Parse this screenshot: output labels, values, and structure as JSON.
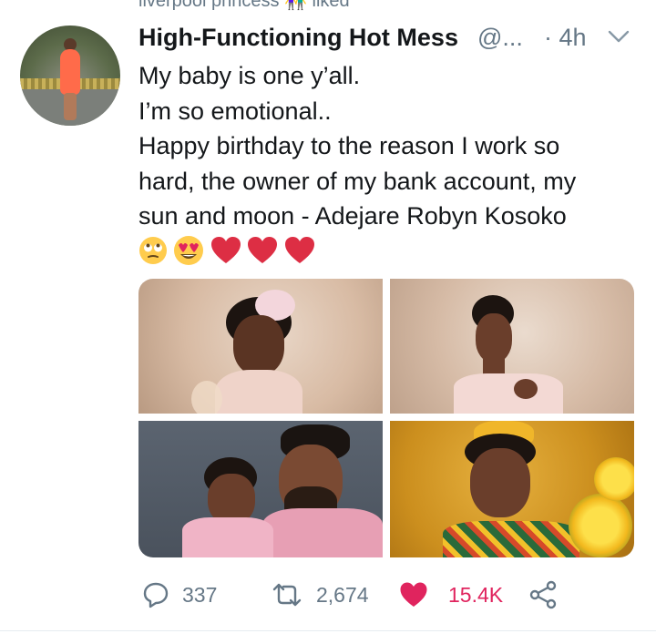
{
  "top_context": {
    "text": "liverpool princess 👫 liked"
  },
  "tweet": {
    "author_name": "High-Functioning Hot Mess",
    "handle": "@...",
    "time": "· 4h",
    "lines": [
      "My baby is one y’all.",
      "I’m so emotional..",
      "Happy birthday to the reason I work so",
      "hard, the owner of my bank account, my",
      "sun and moon - Adejare Robyn Kosoko"
    ],
    "emojis": [
      "face-with-rolling-eyes",
      "smiling-face-with-heart-eyes",
      "red-heart",
      "red-heart",
      "red-heart"
    ],
    "photos": [
      "baby-portrait-pink-bow",
      "woman-portrait-pink-dress",
      "father-and-baby-pink-outfits",
      "baby-portrait-yellow-flowers"
    ]
  },
  "actions": {
    "replies": "337",
    "retweets": "2,674",
    "likes": "15.4K"
  },
  "colors": {
    "like": "#e0245e",
    "muted": "#657786",
    "text": "#14171a"
  }
}
